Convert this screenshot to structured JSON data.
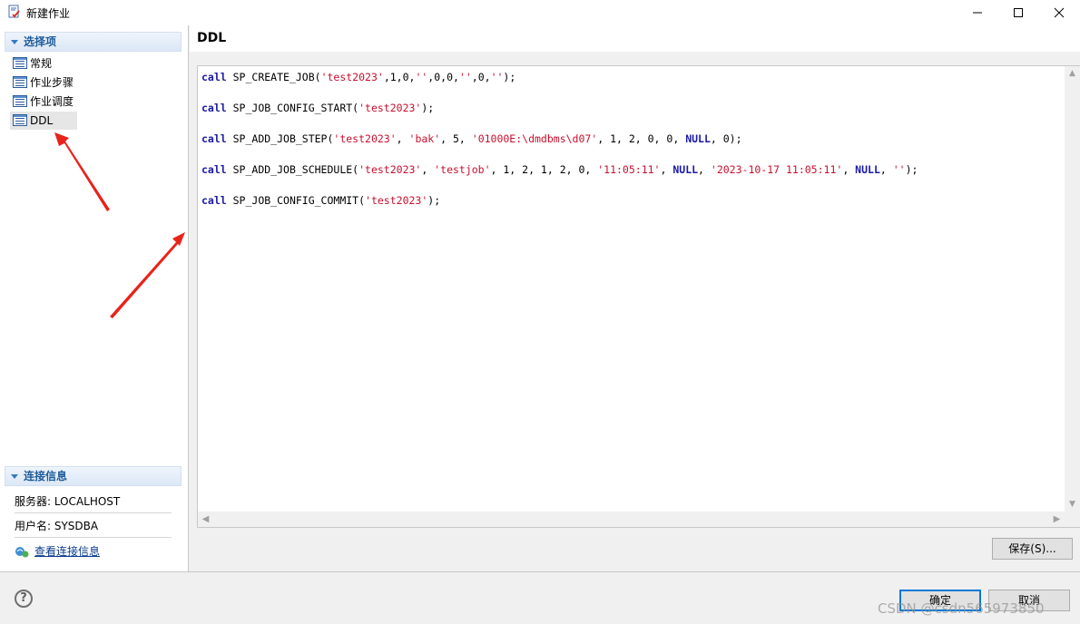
{
  "window": {
    "title": "新建作业",
    "icon": "job-icon",
    "controls": [
      "minimize-icon",
      "maximize-icon",
      "close-icon"
    ]
  },
  "sidebar": {
    "section_label": "选择项",
    "items": [
      {
        "label": "常规",
        "icon": "list-icon",
        "selected": false
      },
      {
        "label": "作业步骤",
        "icon": "list-icon",
        "selected": false
      },
      {
        "label": "作业调度",
        "icon": "list-icon",
        "selected": false
      },
      {
        "label": "DDL",
        "icon": "list-icon",
        "selected": true
      }
    ]
  },
  "connection": {
    "section_label": "连接信息",
    "server": "服务器: LOCALHOST",
    "user": "用户名: SYSDBA",
    "link": "查看连接信息",
    "link_icon": "connection-info-icon"
  },
  "main": {
    "heading": "DDL",
    "code_lines": [
      "call SP_CREATE_JOB('test2023',1,0,'',0,0,'',0,'');",
      "call SP_JOB_CONFIG_START('test2023');",
      "call SP_ADD_JOB_STEP('test2023', 'bak', 5, '01000E:\\dmdbms\\d07', 1, 2, 0, 0, NULL, 0);",
      "call SP_ADD_JOB_SCHEDULE('test2023', 'testjob', 1, 2, 1, 2, 0, '11:05:11', NULL, '2023-10-17 11:05:11', NULL, '');",
      "call SP_JOB_CONFIG_COMMIT('test2023');"
    ],
    "save_button": "保存(S)..."
  },
  "footer": {
    "ok_button": "确定",
    "cancel_button": "取消",
    "help_icon": "help-icon",
    "watermark": "CSDN @csdn565973850"
  },
  "colors": {
    "keyword": "#1a1aa6",
    "string": "#c8102e",
    "accent": "#0078d7",
    "annotation_arrow": "#e8231b"
  }
}
